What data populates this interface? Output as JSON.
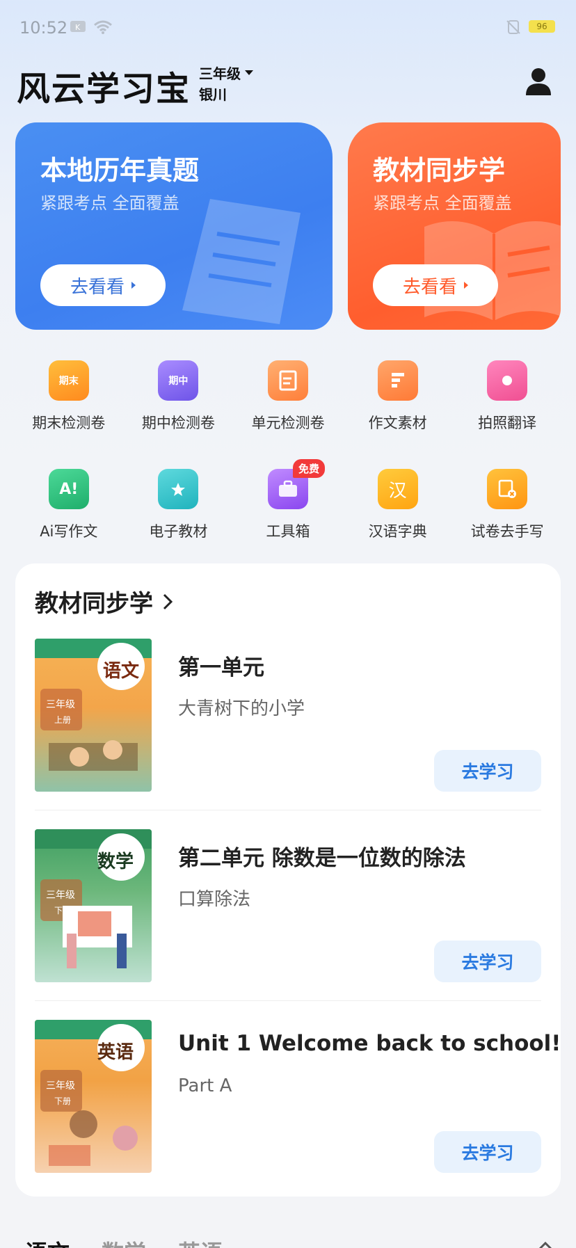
{
  "status": {
    "time": "10:52",
    "battery": "96"
  },
  "header": {
    "app_title": "风云学习宝",
    "grade": "三年级",
    "city": "银川"
  },
  "banners": [
    {
      "title": "本地历年真题",
      "subtitle": "紧跟考点 全面覆盖",
      "button": "去看看",
      "color": "#3d7ff0"
    },
    {
      "title": "教材同步学",
      "subtitle": "紧跟考点 全面覆盖",
      "button": "去看看",
      "color": "#ff5e2e"
    }
  ],
  "grid": [
    {
      "label": "期末检测卷",
      "icon": "final-exam-icon",
      "icon_text": "期末",
      "color": "#ff9e2c"
    },
    {
      "label": "期中检测卷",
      "icon": "midterm-exam-icon",
      "icon_text": "期中",
      "color": "#8b6cf2"
    },
    {
      "label": "单元检测卷",
      "icon": "unit-test-icon",
      "icon_text": "",
      "color": "#ff9848"
    },
    {
      "label": "作文素材",
      "icon": "essay-material-icon",
      "icon_text": "",
      "color": "#ff8c4a"
    },
    {
      "label": "拍照翻译",
      "icon": "photo-translate-icon",
      "icon_text": "",
      "color": "#f45c9a"
    },
    {
      "label": "Ai写作文",
      "icon": "ai-essay-icon",
      "icon_text": "A!",
      "color": "#2ec27e"
    },
    {
      "label": "电子教材",
      "icon": "e-textbook-icon",
      "icon_text": "",
      "color": "#2fc5cc"
    },
    {
      "label": "工具箱",
      "icon": "toolbox-icon",
      "icon_text": "",
      "color": "#9a5cf2",
      "badge": "免费"
    },
    {
      "label": "汉语字典",
      "icon": "chinese-dictionary-icon",
      "icon_text": "汉",
      "color": "#ffb21e"
    },
    {
      "label": "试卷去手写",
      "icon": "remove-handwriting-icon",
      "icon_text": "",
      "color": "#ffa51e"
    }
  ],
  "sync": {
    "heading": "教材同步学",
    "lessons": [
      {
        "title": "第一单元",
        "subtitle": "大青树下的小学",
        "button": "去学习",
        "cover_text": "语文",
        "cover_grade": "三年级",
        "cover_term": "上册",
        "cover_color": "#f3a54a"
      },
      {
        "title": "第二单元 除数是一位数的除法",
        "subtitle": "口算除法",
        "button": "去学习",
        "cover_text": "数学",
        "cover_grade": "三年级",
        "cover_term": "下册",
        "cover_color": "#4aa06a"
      },
      {
        "title": "Unit 1 Welcome back to school!",
        "subtitle": "Part A",
        "button": "去学习",
        "cover_text": "英语",
        "cover_grade": "三年级",
        "cover_term": "下册",
        "cover_color": "#f2a245"
      }
    ]
  },
  "tabs": [
    "语文",
    "数学",
    "英语"
  ]
}
